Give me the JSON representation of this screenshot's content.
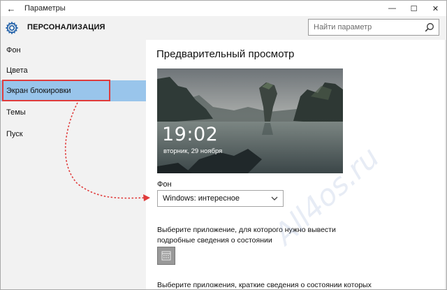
{
  "window": {
    "title": "Параметры",
    "back_glyph": "←",
    "minimize_glyph": "—",
    "maximize_glyph": "☐",
    "close_glyph": "✕"
  },
  "header": {
    "title": "ПЕРСОНАЛИЗАЦИЯ",
    "icon": "gear-icon"
  },
  "search": {
    "placeholder": "Найти параметр",
    "icon": "search-icon"
  },
  "sidebar": {
    "items": [
      {
        "label": "Фон",
        "selected": false
      },
      {
        "label": "Цвета",
        "selected": false
      },
      {
        "label": "Экран блокировки",
        "selected": true
      },
      {
        "label": "Темы",
        "selected": false
      },
      {
        "label": "Пуск",
        "selected": false
      }
    ]
  },
  "main": {
    "preview_title": "Предварительный просмотр",
    "preview": {
      "time": "19:02",
      "date": "вторник, 29 ноября"
    },
    "background_label": "Фон",
    "background_value": "Windows: интересное",
    "detailed_status_label": "Выберите приложение, для которого нужно вывести подробные сведения о состоянии",
    "quick_status_label": "Выберите приложения, краткие сведения о состоянии которых"
  },
  "annotation": {
    "arrow_color": "#e03c3c",
    "highlight_color": "#e03c3c"
  },
  "watermark": "All4os.ru",
  "colors": {
    "accent_selected": "#99c5eb",
    "sidebar_bg": "#f2f2f2"
  }
}
